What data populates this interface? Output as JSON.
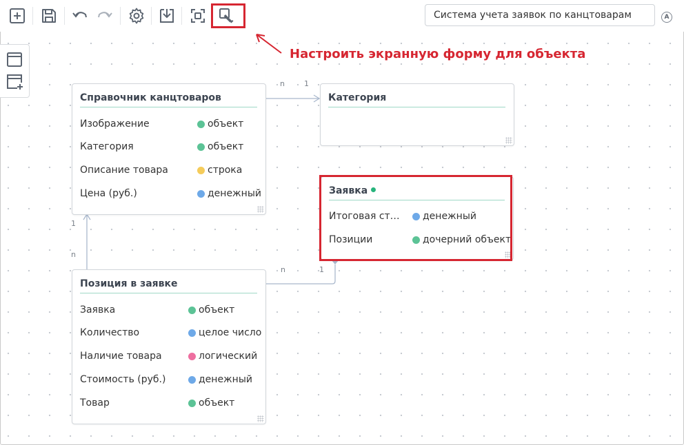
{
  "toolbar": {
    "buttons": [
      {
        "name": "add",
        "icon": "add-square-icon"
      },
      {
        "name": "save",
        "icon": "floppy-disk-icon"
      },
      {
        "name": "undo",
        "icon": "undo-icon"
      },
      {
        "name": "redo",
        "icon": "redo-icon"
      },
      {
        "name": "settings",
        "icon": "gear-icon"
      },
      {
        "name": "download",
        "icon": "download-icon"
      },
      {
        "name": "scan",
        "icon": "scan-icon"
      },
      {
        "name": "form-designer",
        "icon": "form-edit-icon"
      }
    ],
    "system_name": "Система учета заявок по канцтоварам",
    "account_icon": "A"
  },
  "annotation": {
    "text": "Настроить экранную форму для объекта",
    "color": "#d62631"
  },
  "side_panel": {
    "buttons": [
      "window-icon",
      "add-window-icon"
    ]
  },
  "cards": {
    "directory": {
      "title": "Справочник канцтоваров",
      "rows": [
        {
          "label": "Изображение",
          "type": "объект",
          "color": "#5cc396"
        },
        {
          "label": "Категория",
          "type": "объект",
          "color": "#5cc396"
        },
        {
          "label": "Описание товара",
          "type": "строка",
          "color": "#f5cc5b"
        },
        {
          "label": "Цена (руб.)",
          "type": "денежный",
          "color": "#6ea9e8"
        }
      ]
    },
    "category": {
      "title": "Категория",
      "rows": []
    },
    "order": {
      "title": "Заявка",
      "status_color": "#27b47c",
      "rows": [
        {
          "label": "Итоговая ст…",
          "type": "денежный",
          "color": "#6ea9e8"
        },
        {
          "label": "Позиции",
          "type": "дочерний объект",
          "color": "#5cc396"
        }
      ]
    },
    "position": {
      "title": "Позиция в заявке",
      "rows": [
        {
          "label": "Заявка",
          "type": "объект",
          "color": "#5cc396"
        },
        {
          "label": "Количество",
          "type": "целое число",
          "color": "#6ea9e8"
        },
        {
          "label": "Наличие товара",
          "type": "логический",
          "color": "#ee6fa0"
        },
        {
          "label": "Стоимость (руб.)",
          "type": "денежный",
          "color": "#6ea9e8"
        },
        {
          "label": "Товар",
          "type": "объект",
          "color": "#5cc396"
        }
      ]
    }
  },
  "relations": [
    {
      "from": "Справочник канцтоваров",
      "to": "Категория",
      "from_mult": "n",
      "to_mult": "1"
    },
    {
      "from": "Позиция в заявке",
      "to": "Справочник канцтоваров",
      "from_mult": "n",
      "to_mult": "1"
    },
    {
      "from": "Позиция в заявке",
      "to": "Заявка",
      "from_mult": "n",
      "to_mult": "1"
    }
  ],
  "colors": {
    "accent_green": "#9ed8c6",
    "highlight_red": "#d62631",
    "connector": "#a9b8cc"
  }
}
